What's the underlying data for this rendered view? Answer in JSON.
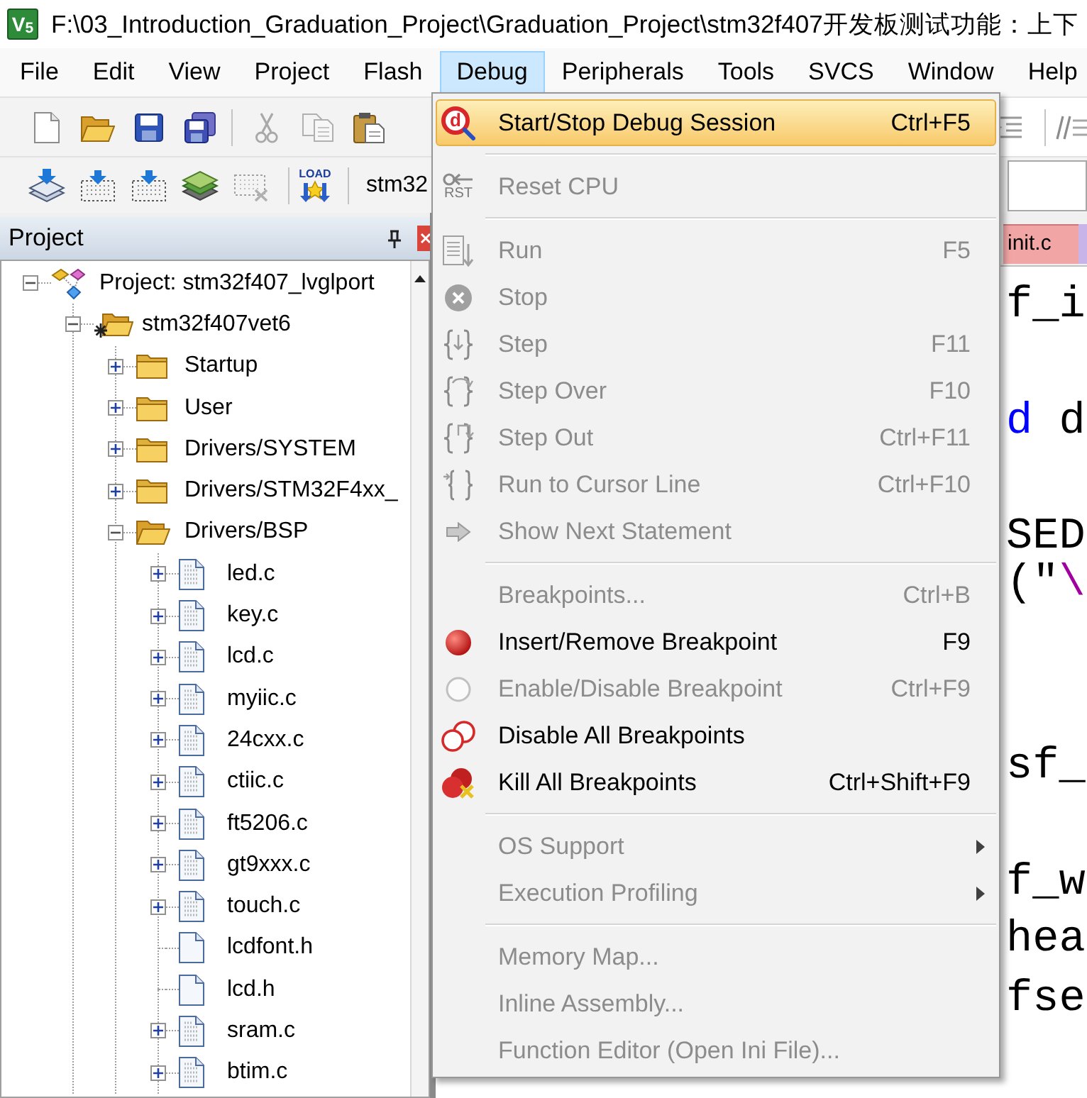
{
  "window": {
    "icon_text": "V$_{5}$",
    "title": "F:\\03_Introduction_Graduation_Project\\Graduation_Project\\stm32f407开发板测试功能：上下"
  },
  "menu_bar": [
    {
      "label": "File",
      "selected": false
    },
    {
      "label": "Edit",
      "selected": false
    },
    {
      "label": "View",
      "selected": false
    },
    {
      "label": "Project",
      "selected": false
    },
    {
      "label": "Flash",
      "selected": false
    },
    {
      "label": "Debug",
      "selected": true
    },
    {
      "label": "Peripherals",
      "selected": false
    },
    {
      "label": "Tools",
      "selected": false
    },
    {
      "label": "SVCS",
      "selected": false
    },
    {
      "label": "Window",
      "selected": false
    },
    {
      "label": "Help",
      "selected": false
    }
  ],
  "toolbar_2": {
    "load_icon_text": "LOAD",
    "target": "stm32"
  },
  "project_panel": {
    "title": "Project",
    "tree": [
      {
        "kind": "project",
        "label": "Project: stm32f407_lvglport",
        "expanded": true,
        "children": [
          {
            "kind": "target",
            "label": "stm32f407vet6",
            "expanded": true,
            "children": [
              {
                "kind": "group",
                "label": "Startup",
                "expanded": false
              },
              {
                "kind": "group",
                "label": "User",
                "expanded": false
              },
              {
                "kind": "group",
                "label": "Drivers/SYSTEM",
                "expanded": false
              },
              {
                "kind": "group",
                "label": "Drivers/STM32F4xx_",
                "expanded": false
              },
              {
                "kind": "group",
                "label": "Drivers/BSP",
                "expanded": true,
                "children": [
                  {
                    "kind": "source",
                    "label": "led.c",
                    "expanded": false
                  },
                  {
                    "kind": "source",
                    "label": "key.c",
                    "expanded": false
                  },
                  {
                    "kind": "source",
                    "label": "lcd.c",
                    "expanded": false
                  },
                  {
                    "kind": "source",
                    "label": "myiic.c",
                    "expanded": false
                  },
                  {
                    "kind": "source",
                    "label": "24cxx.c",
                    "expanded": false
                  },
                  {
                    "kind": "source",
                    "label": "ctiic.c",
                    "expanded": false
                  },
                  {
                    "kind": "source",
                    "label": "ft5206.c",
                    "expanded": false
                  },
                  {
                    "kind": "source",
                    "label": "gt9xxx.c",
                    "expanded": false
                  },
                  {
                    "kind": "source",
                    "label": "touch.c",
                    "expanded": false
                  },
                  {
                    "kind": "header",
                    "label": "lcdfont.h"
                  },
                  {
                    "kind": "header",
                    "label": "lcd.h"
                  },
                  {
                    "kind": "source",
                    "label": "sram.c",
                    "expanded": false
                  },
                  {
                    "kind": "source",
                    "label": "btim.c",
                    "expanded": false
                  }
                ]
              }
            ]
          }
        ]
      }
    ]
  },
  "editor": {
    "tab": "init.c",
    "code_lines": [
      {
        "segments": [
          {
            "kind": "plain",
            "text": "f_i"
          }
        ]
      },
      {
        "segments": [
          {
            "kind": "keyword",
            "text": "d"
          },
          {
            "kind": "plain",
            "text": " d"
          }
        ]
      },
      {
        "segments": [
          {
            "kind": "plain",
            "text": "SED"
          }
        ]
      },
      {
        "segments": [
          {
            "kind": "plain",
            "text": "(\""
          },
          {
            "kind": "string",
            "text": "\\"
          }
        ]
      },
      {
        "segments": [
          {
            "kind": "plain",
            "text": "sf_"
          }
        ]
      },
      {
        "segments": [
          {
            "kind": "plain",
            "text": "f_w"
          }
        ]
      },
      {
        "segments": [
          {
            "kind": "plain",
            "text": "hea"
          }
        ]
      },
      {
        "segments": [
          {
            "kind": "plain",
            "text": "fse"
          }
        ]
      }
    ]
  },
  "debug_menu": {
    "items": [
      {
        "kind": "command",
        "label": "Start/Stop Debug Session",
        "shortcut": "Ctrl+F5",
        "icon_text": "d",
        "selected": true,
        "disabled": false,
        "submenu": false
      },
      {
        "kind": "separator"
      },
      {
        "kind": "command",
        "label": "Reset CPU",
        "icon_text": "RST",
        "selected": false,
        "disabled": true,
        "submenu": false
      },
      {
        "kind": "separator"
      },
      {
        "kind": "command",
        "label": "Run",
        "shortcut": "F5",
        "selected": false,
        "disabled": true,
        "submenu": false
      },
      {
        "kind": "command",
        "label": "Stop",
        "selected": false,
        "disabled": true,
        "submenu": false
      },
      {
        "kind": "command",
        "label": "Step",
        "shortcut": "F11",
        "selected": false,
        "disabled": true,
        "submenu": false
      },
      {
        "kind": "command",
        "label": "Step Over",
        "shortcut": "F10",
        "selected": false,
        "disabled": true,
        "submenu": false
      },
      {
        "kind": "command",
        "label": "Step Out",
        "shortcut": "Ctrl+F11",
        "selected": false,
        "disabled": true,
        "submenu": false
      },
      {
        "kind": "command",
        "label": "Run to Cursor Line",
        "shortcut": "Ctrl+F10",
        "selected": false,
        "disabled": true,
        "submenu": false
      },
      {
        "kind": "command",
        "label": "Show Next Statement",
        "selected": false,
        "disabled": true,
        "submenu": false
      },
      {
        "kind": "separator"
      },
      {
        "kind": "command",
        "label": "Breakpoints...",
        "shortcut": "Ctrl+B",
        "selected": false,
        "disabled": true,
        "submenu": false
      },
      {
        "kind": "command",
        "label": "Insert/Remove Breakpoint",
        "shortcut": "F9",
        "selected": false,
        "disabled": false,
        "submenu": false
      },
      {
        "kind": "command",
        "label": "Enable/Disable Breakpoint",
        "shortcut": "Ctrl+F9",
        "selected": false,
        "disabled": true,
        "submenu": false
      },
      {
        "kind": "command",
        "label": "Disable All Breakpoints",
        "selected": false,
        "disabled": false,
        "submenu": false
      },
      {
        "kind": "command",
        "label": "Kill All Breakpoints",
        "shortcut": "Ctrl+Shift+F9",
        "selected": false,
        "disabled": false,
        "submenu": false
      },
      {
        "kind": "separator"
      },
      {
        "kind": "command",
        "label": "OS Support",
        "selected": false,
        "disabled": true,
        "submenu": true
      },
      {
        "kind": "command",
        "label": "Execution Profiling",
        "selected": false,
        "disabled": true,
        "submenu": true
      },
      {
        "kind": "separator"
      },
      {
        "kind": "command",
        "label": "Memory Map...",
        "selected": false,
        "disabled": true,
        "submenu": false
      },
      {
        "kind": "command",
        "label": "Inline Assembly...",
        "selected": false,
        "disabled": true,
        "submenu": false
      },
      {
        "kind": "command",
        "label": "Function Editor (Open Ini File)...",
        "selected": false,
        "disabled": true,
        "submenu": false
      }
    ]
  }
}
